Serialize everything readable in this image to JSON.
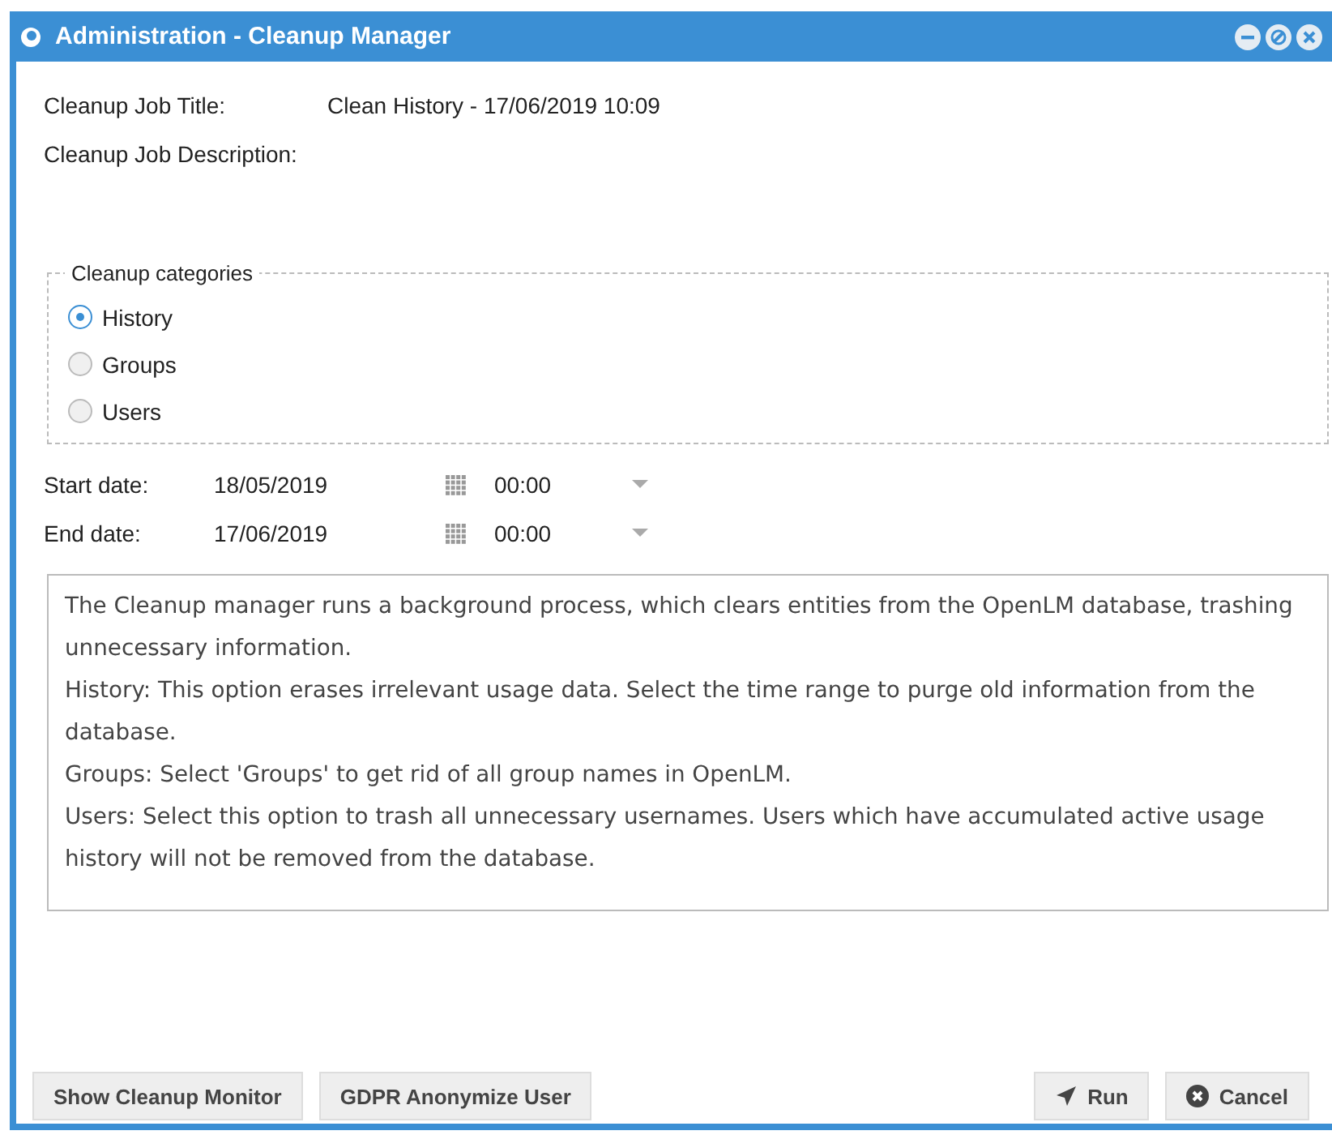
{
  "window": {
    "title": "Administration - Cleanup Manager"
  },
  "fields": [
    {
      "label": "Cleanup Job Title:",
      "value": "Clean History - 17/06/2019 10:09"
    },
    {
      "label": "Cleanup Job Description:"
    }
  ],
  "categories": {
    "legend": "Cleanup categories",
    "options": [
      {
        "label": "History",
        "selected": true
      },
      {
        "label": "Groups",
        "selected": false
      },
      {
        "label": "Users",
        "selected": false
      }
    ]
  },
  "dates": [
    {
      "label": "Start date:",
      "date": "18/05/2019",
      "time": "00:00"
    },
    {
      "label": "End date:",
      "date": "17/06/2019",
      "time": "00:00"
    }
  ],
  "info_lines": [
    "The Cleanup manager runs a background process, which clears entities from the OpenLM database, trashing unnecessary information.",
    "History: This option erases irrelevant usage data. Select the time range to purge old information from the database.",
    "Groups: Select 'Groups' to get rid of all group names in OpenLM.",
    "Users: Select this option to trash all unnecessary usernames. Users which have accumulated active usage history will not be removed from the database."
  ],
  "buttons_left": [
    "Show Cleanup Monitor",
    "GDPR Anonymize User"
  ],
  "buttons_right": [
    {
      "kind": "run",
      "label": "Run"
    },
    {
      "kind": "cancel",
      "label": "Cancel"
    }
  ]
}
